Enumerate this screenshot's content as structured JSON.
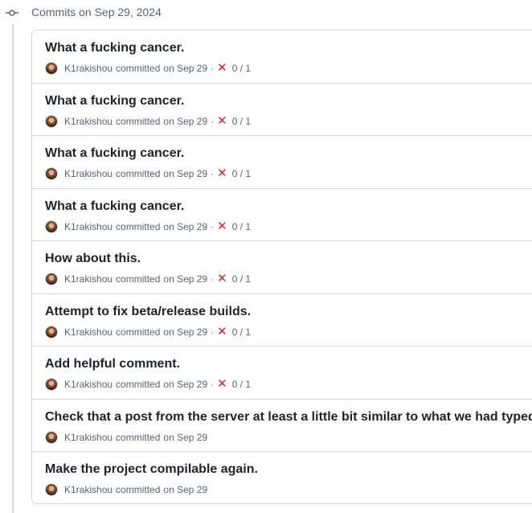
{
  "group": {
    "title": "Commits on Sep 29, 2024"
  },
  "commits": [
    {
      "title": "What a fucking cancer.",
      "author": "K1rakishou",
      "action": "committed",
      "date": "on Sep 29",
      "status": "failure",
      "status_symbol": "✕",
      "checks": "0 / 1"
    },
    {
      "title": "What a fucking cancer.",
      "author": "K1rakishou",
      "action": "committed",
      "date": "on Sep 29",
      "status": "failure",
      "status_symbol": "✕",
      "checks": "0 / 1"
    },
    {
      "title": "What a fucking cancer.",
      "author": "K1rakishou",
      "action": "committed",
      "date": "on Sep 29",
      "status": "failure",
      "status_symbol": "✕",
      "checks": "0 / 1"
    },
    {
      "title": "What a fucking cancer.",
      "author": "K1rakishou",
      "action": "committed",
      "date": "on Sep 29",
      "status": "failure",
      "status_symbol": "✕",
      "checks": "0 / 1"
    },
    {
      "title": "How about this.",
      "author": "K1rakishou",
      "action": "committed",
      "date": "on Sep 29",
      "status": "failure",
      "status_symbol": "✕",
      "checks": "0 / 1"
    },
    {
      "title": "Attempt to fix beta/release builds.",
      "author": "K1rakishou",
      "action": "committed",
      "date": "on Sep 29",
      "status": "failure",
      "status_symbol": "✕",
      "checks": "0 / 1"
    },
    {
      "title": "Add helpful comment.",
      "author": "K1rakishou",
      "action": "committed",
      "date": "on Sep 29",
      "status": "failure",
      "status_symbol": "✕",
      "checks": "0 / 1"
    },
    {
      "title": "Check that a post from the server at least a little bit similar to what we had typed.",
      "author": "K1rakishou",
      "action": "committed",
      "date": "on Sep 29",
      "status": null,
      "status_symbol": null,
      "checks": null
    },
    {
      "title": "Make the project compilable again.",
      "author": "K1rakishou",
      "action": "committed",
      "date": "on Sep 29",
      "status": null,
      "status_symbol": null,
      "checks": null
    }
  ],
  "colors": {
    "failure": "#d1242f",
    "muted": "#59636e",
    "border": "#d1d9e0"
  }
}
